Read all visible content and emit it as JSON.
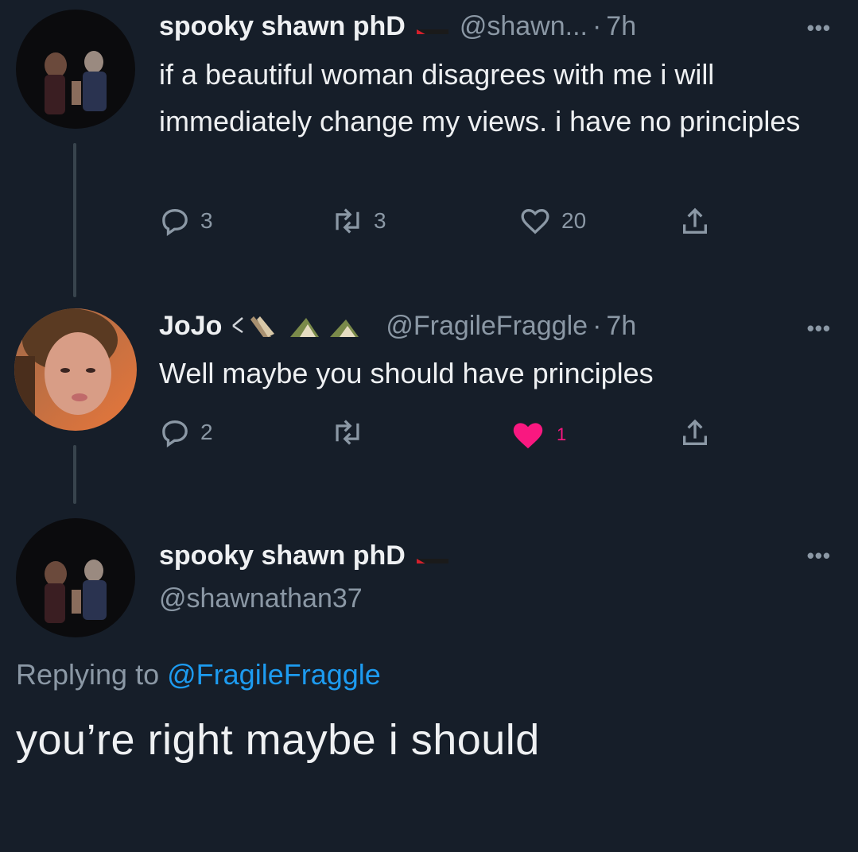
{
  "tweets": [
    {
      "name": "spooky shawn phD",
      "handle": "@shawn...",
      "sep": "·",
      "time": "7h",
      "text": "if a beautiful woman disagrees with me i will immediately change my views. i have no principles",
      "replies": "3",
      "retweets": "3",
      "likes": "20",
      "liked": false
    },
    {
      "name": "JoJo",
      "handle": "@FragileFraggle",
      "sep": "·",
      "time": "7h",
      "text": "Well maybe you should have principles",
      "replies": "2",
      "retweets": "",
      "likes": "1",
      "liked": true
    }
  ],
  "main_tweet": {
    "name": "spooky shawn phD",
    "handle": "@shawnathan37",
    "replying_label": "Replying to",
    "replying_handle": "@FragileFraggle",
    "text": "you’re right maybe i should"
  },
  "icons": {
    "reply": "reply-icon",
    "retweet": "retweet-icon",
    "like": "heart-icon",
    "share": "share-icon",
    "more": "more-icon",
    "flag": "palestine-flag-icon"
  },
  "colors": {
    "background": "#161e29",
    "text": "#eef0f2",
    "muted": "#8b98a5",
    "link": "#1d9bf0",
    "like_active": "#f91880"
  }
}
